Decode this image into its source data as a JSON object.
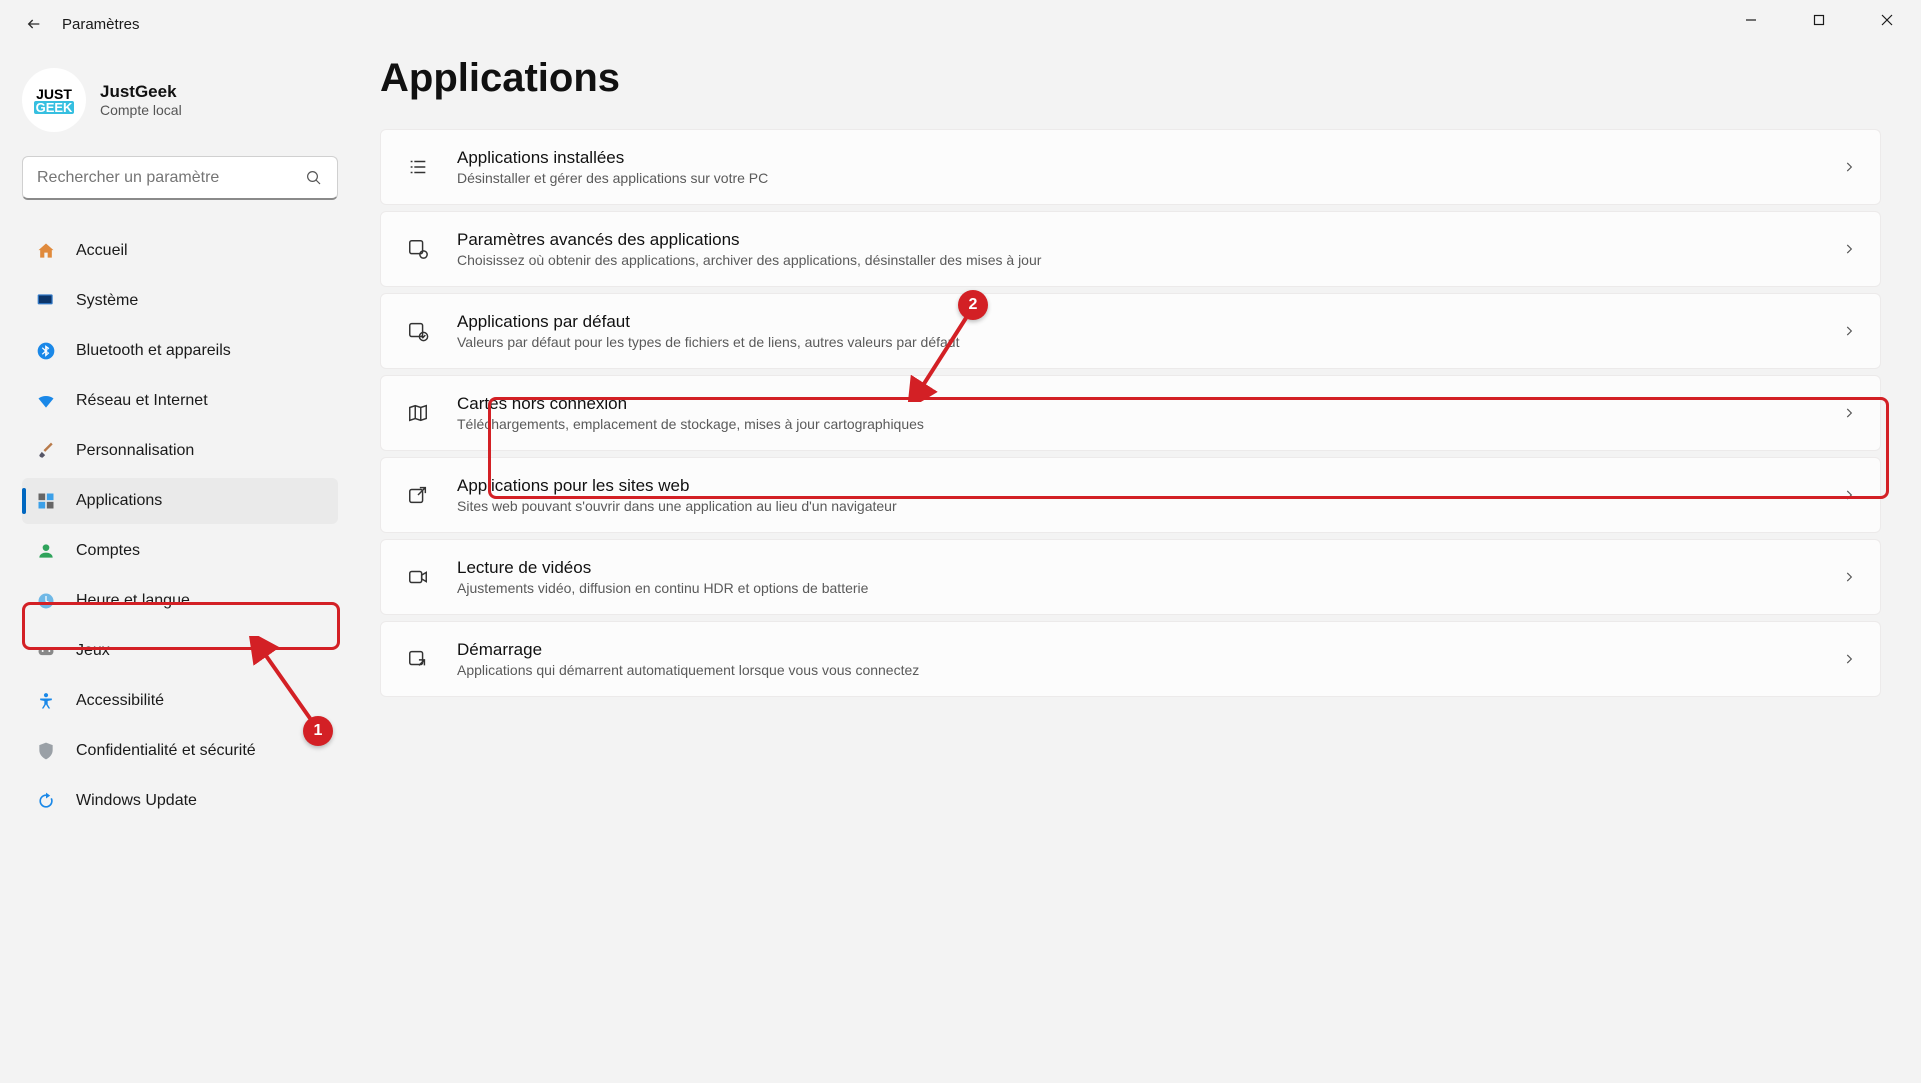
{
  "window": {
    "title": "Paramètres"
  },
  "profile": {
    "name": "JustGeek",
    "subtitle": "Compte local",
    "avatar_line1": "JUST",
    "avatar_line2": "GEEK"
  },
  "search": {
    "placeholder": "Rechercher un paramètre"
  },
  "nav": {
    "items": [
      {
        "label": "Accueil"
      },
      {
        "label": "Système"
      },
      {
        "label": "Bluetooth et appareils"
      },
      {
        "label": "Réseau et Internet"
      },
      {
        "label": "Personnalisation"
      },
      {
        "label": "Applications"
      },
      {
        "label": "Comptes"
      },
      {
        "label": "Heure et langue"
      },
      {
        "label": "Jeux"
      },
      {
        "label": "Accessibilité"
      },
      {
        "label": "Confidentialité et sécurité"
      },
      {
        "label": "Windows Update"
      }
    ],
    "active_index": 5
  },
  "page": {
    "title": "Applications",
    "cards": [
      {
        "title": "Applications installées",
        "subtitle": "Désinstaller et gérer des applications sur votre PC"
      },
      {
        "title": "Paramètres avancés des applications",
        "subtitle": "Choisissez où obtenir des applications, archiver des applications, désinstaller des mises à jour"
      },
      {
        "title": "Applications par défaut",
        "subtitle": "Valeurs par défaut pour les types de fichiers et de liens, autres valeurs par défaut"
      },
      {
        "title": "Cartes hors connexion",
        "subtitle": "Téléchargements, emplacement de stockage, mises à jour cartographiques"
      },
      {
        "title": "Applications pour les sites web",
        "subtitle": "Sites web pouvant s'ouvrir dans une application au lieu d'un navigateur"
      },
      {
        "title": "Lecture de vidéos",
        "subtitle": "Ajustements vidéo, diffusion en continu HDR et options de batterie"
      },
      {
        "title": "Démarrage",
        "subtitle": "Applications qui démarrent automatiquement lorsque vous vous connectez"
      }
    ]
  },
  "annotations": {
    "badge1": "1",
    "badge2": "2"
  },
  "colors": {
    "accent": "#0067c0",
    "annotation": "#d32025"
  }
}
